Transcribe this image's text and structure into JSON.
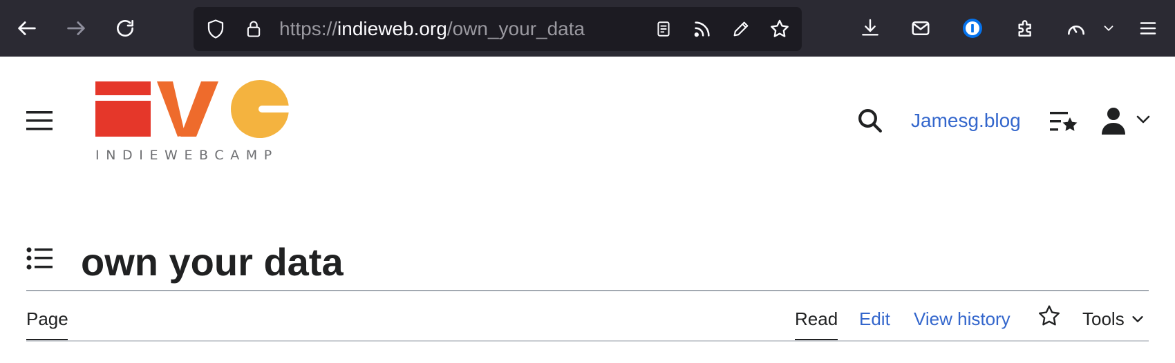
{
  "browser": {
    "url_scheme": "https://",
    "url_host": "indieweb.org",
    "url_path": "/own_your_data"
  },
  "site": {
    "logo_text": "INDIEWEBCAMP",
    "logo_colors": {
      "red": "#e5372a",
      "orange": "#ee6b2c",
      "yellow": "#f4b33f",
      "gray": "#6d6e71"
    },
    "user_link": "Jamesg.blog"
  },
  "page": {
    "title": "own your data",
    "tabs": {
      "page": "Page",
      "read": "Read",
      "edit": "Edit",
      "history": "View history",
      "tools": "Tools"
    }
  },
  "colors": {
    "link": "#3366cc",
    "text": "#202122",
    "toolbar": "#2b2a33"
  }
}
